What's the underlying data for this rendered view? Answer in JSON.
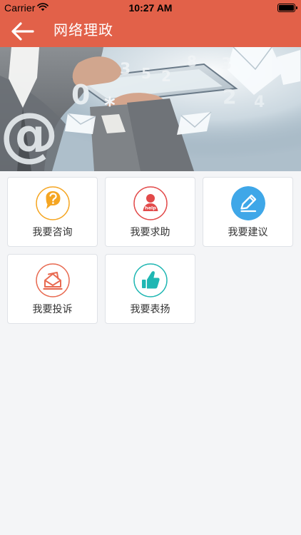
{
  "status_bar": {
    "carrier": "Carrier",
    "time": "10:27 AM"
  },
  "navbar": {
    "title": "网络理政"
  },
  "colors": {
    "header": "#e26149",
    "background": "#f4f5f7",
    "card_border": "#dfe2e7",
    "consult": "#f5a623",
    "help": "#e24a4a",
    "suggest": "#3fa7e8",
    "complain": "#e86a51",
    "praise": "#20b7b3"
  },
  "icons": [
    "back-arrow-icon",
    "wifi-icon",
    "battery-icon",
    "question-bubble-icon",
    "help-person-icon",
    "pencil-icon",
    "complaint-envelope-icon",
    "thumbs-up-icon"
  ],
  "services": [
    {
      "label": "我要咨询"
    },
    {
      "label": "我要求助",
      "icon_text": "help"
    },
    {
      "label": "我要建议"
    },
    {
      "label": "我要投诉"
    },
    {
      "label": "我要表扬"
    }
  ]
}
